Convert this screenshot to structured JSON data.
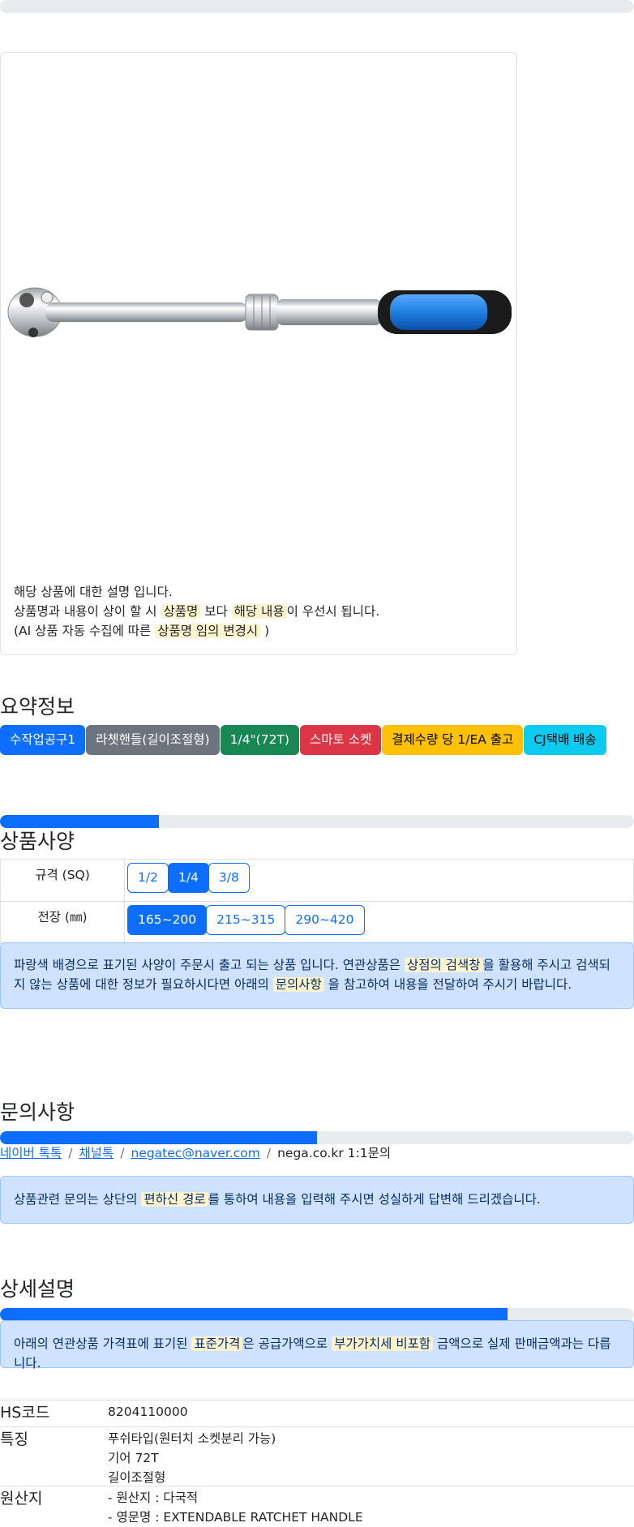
{
  "product": {
    "description_lines": [
      {
        "prefix": "해당 상품에 대한 설명 입니다.",
        "parts": []
      },
      {
        "parts": [
          "상품명과 내용이 상이 할 시 ",
          "상품명",
          " 보다 ",
          "해당 내용",
          "이 우선시 됩니다."
        ]
      },
      {
        "parts": [
          "(AI 상품 자동 수집에 따른 ",
          "상품명 임의 변경시",
          " )"
        ]
      }
    ],
    "line1": "해당 상품에 대한 설명 입니다.",
    "line2_a": "상품명과 내용이 상이 할 시 ",
    "line2_b": "상품명",
    "line2_c": " 보다 ",
    "line2_d": "해당 내용",
    "line2_e": "이 우선시 됩니다.",
    "line3_a": "(AI 상품 자동 수집에 따른 ",
    "line3_b": "상품명 임의 변경시",
    "line3_c": " )"
  },
  "summary": {
    "title": "요약정보",
    "badges": [
      {
        "label": "수작업공구1",
        "color": "#0d6efd"
      },
      {
        "label": "라쳇핸들(길이조절형)",
        "color": "#6c757d"
      },
      {
        "label": "1/4\"(72T)",
        "color": "#198754"
      },
      {
        "label": "스마토 소켓",
        "color": "#dc3545"
      },
      {
        "label": "결제수량 당 1/EA 출고",
        "color": "#ffc107"
      },
      {
        "label": "CJ택배 배송",
        "color": "#0dcaf0"
      }
    ]
  },
  "spec": {
    "title": "상품사양",
    "progress": 0.25,
    "rows": [
      {
        "label": "규격 (SQ)",
        "options": [
          "1/2",
          "1/4",
          "3/8"
        ],
        "selected": 1
      },
      {
        "label": "전장 (㎜)",
        "options": [
          "165~200",
          "215~315",
          "290~420"
        ],
        "selected": 0
      }
    ],
    "notice_a": "파랑색 배경으로 표기된 사양이 주문시 출고 되는 상품 입니다. 연관상품은 ",
    "notice_b": "상점의 검색창",
    "notice_c": "을 활용해 주시고 검색되지 않는 상품에 대한 정보가 필요하시다면 아래의 ",
    "notice_d": "문의사항",
    "notice_e": " 을 참고하여 내용을 전달하여 주시기 바랍니다."
  },
  "inquiry": {
    "title": "문의사항",
    "progress": 0.5,
    "links": [
      "네이버 톡톡",
      "채널톡",
      "negatec@naver.com"
    ],
    "plain": "nega.co.kr 1:1문의",
    "sep": "/",
    "notice_a": "상품관련 문의는 상단의 ",
    "notice_b": "편하신 경로",
    "notice_c": "를 통하여 내용을 입력해 주시면 성실하게 답변해 드리겠습니다."
  },
  "detail": {
    "title": "상세설명",
    "progress": 0.8,
    "notice_a": "아래의 연관상품 가격표에 표기된 ",
    "notice_b": "표준가격",
    "notice_c": "은 공급가액으로 ",
    "notice_d": "부가가치세 비포함",
    "notice_e": " 금액으로 실제 판매금액과는 다릅니다.",
    "rows": [
      {
        "key": "HS코드",
        "lines": [
          "8204110000"
        ]
      },
      {
        "key": "특징",
        "lines": [
          "푸쉬타입(원터치 소켓분리 가능)",
          "기어 72T",
          "길이조절형"
        ]
      },
      {
        "key": "원산지",
        "lines": [
          "- 원산지 : 다국적",
          "- 영문명 : EXTENDABLE RATCHET HANDLE"
        ]
      }
    ]
  }
}
